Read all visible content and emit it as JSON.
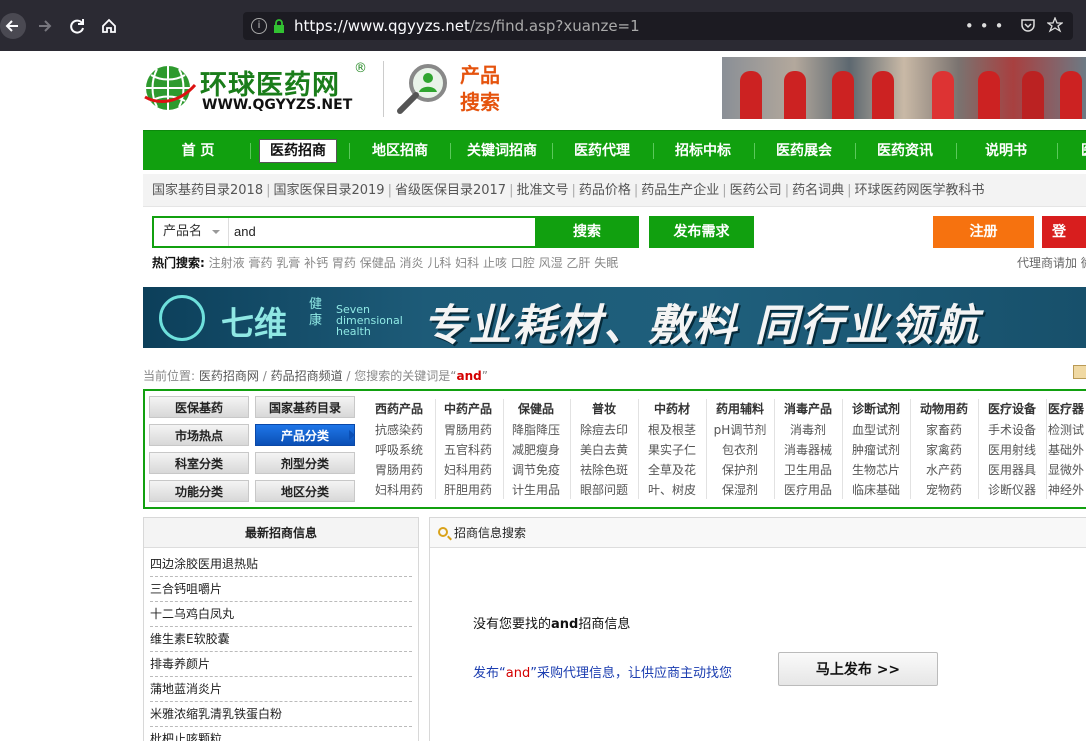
{
  "browser": {
    "url_host": "https://www.qgyyzs.net",
    "url_path": "/zs/find.asp?xuanze=1",
    "menu_glyph": "•••"
  },
  "header": {
    "logo_cn": "环球医药网",
    "logo_en": "WWW.QGYYZS.NET",
    "logo_reg": "®",
    "product_search_line1": "产品",
    "product_search_line2": "搜索"
  },
  "mainnav": {
    "items": [
      "首 页",
      "医药招商",
      "地区招商",
      "关键词招商",
      "医药代理",
      "招标中标",
      "医药展会",
      "医药资讯",
      "说明书",
      "医"
    ],
    "active_index": 1
  },
  "subnav": {
    "items": [
      "国家基药目录2018",
      "国家医保目录2019",
      "省级医保目录2017",
      "批准文号",
      "药品价格",
      "药品生产企业",
      "医药公司",
      "药名词典",
      "环球医药网医学教科书"
    ]
  },
  "search": {
    "category": "产品名",
    "query": "and",
    "search_label": "搜索",
    "publish_label": "发布需求",
    "register_label": "注册",
    "login_label": "登",
    "hot_label": "热门搜索:",
    "hot_terms": "注射液 膏药 乳膏 补钙 胃药 保健品 消炎 儿科 妇科 止咳 口腔 风湿 乙肝 失眠",
    "agent_text": "代理商请加 微"
  },
  "ad": {
    "brand": "七维",
    "brand_sub": "健康",
    "brand_en_1": "Seven",
    "brand_en_2": "dimensional",
    "brand_en_3": "health",
    "slogan": "专业耗材、敷料 同行业领航"
  },
  "breadcrumb": {
    "prefix": "当前位置:",
    "home": "医药招商网",
    "sep": " / ",
    "channel": "药品招商频道",
    "kw_prefix": " / 您搜索的关键词是“",
    "keyword": "and",
    "kw_suffix": "”"
  },
  "categories": {
    "buttons": [
      "医保基药",
      "国家基药目录",
      "市场热点",
      "产品分类",
      "科室分类",
      "剂型分类",
      "功能分类",
      "地区分类"
    ],
    "active_button": "产品分类",
    "columns": [
      {
        "head": "西药产品",
        "items": [
          "抗感染药",
          "呼吸系统",
          "胃肠用药",
          "妇科用药"
        ]
      },
      {
        "head": "中药产品",
        "items": [
          "胃肠用药",
          "五官科药",
          "妇科用药",
          "肝胆用药"
        ]
      },
      {
        "head": "保健品",
        "items": [
          "降脂降压",
          "减肥瘦身",
          "调节免疫",
          "计生用品"
        ]
      },
      {
        "head": "普妆",
        "items": [
          "除痘去印",
          "美白去黄",
          "祛除色斑",
          "眼部问题"
        ]
      },
      {
        "head": "中药材",
        "items": [
          "根及根茎",
          "果实子仁",
          "全草及花",
          "叶、树皮"
        ]
      },
      {
        "head": "药用辅料",
        "items": [
          "pH调节剂",
          "包衣剂",
          "保护剂",
          "保湿剂"
        ]
      },
      {
        "head": "消毒产品",
        "items": [
          "消毒剂",
          "消毒器械",
          "卫生用品",
          "医疗用品"
        ]
      },
      {
        "head": "诊断试剂",
        "items": [
          "血型试剂",
          "肿瘤试剂",
          "生物芯片",
          "临床基础"
        ]
      },
      {
        "head": "动物用药",
        "items": [
          "家畜药",
          "家禽药",
          "水产药",
          "宠物药"
        ]
      },
      {
        "head": "医疗设备",
        "items": [
          "手术设备",
          "医用射线",
          "医用器具",
          "诊断仪器"
        ]
      },
      {
        "head": "医疗器",
        "items": [
          "检测试",
          "基础外",
          "显微外",
          "神经外"
        ]
      }
    ]
  },
  "latest": {
    "title": "最新招商信息",
    "items": [
      "四边涂胶医用退热贴",
      "三合钙咀嚼片",
      "十二乌鸡白凤丸",
      "维生素E软胶囊",
      "排毒养颜片",
      "蒲地蓝消炎片",
      "米雅浓缩乳清乳铁蛋白粉",
      "枇杷止咳颗粒"
    ]
  },
  "results": {
    "title": "招商信息搜索",
    "no_result_prefix": "没有您要找的",
    "no_result_kw": "and",
    "no_result_suffix": "招商信息",
    "publish_prefix": "发布“",
    "publish_kw": "and",
    "publish_suffix": "”采购代理信息，让供应商主动找您",
    "post_button": "马上发布 >>"
  },
  "colors": {
    "brand_green": "#11a00f",
    "orange": "#f6720f",
    "red": "#d81e1e",
    "active_blue": "#0b4fb5",
    "keyword_red": "#d40000"
  }
}
